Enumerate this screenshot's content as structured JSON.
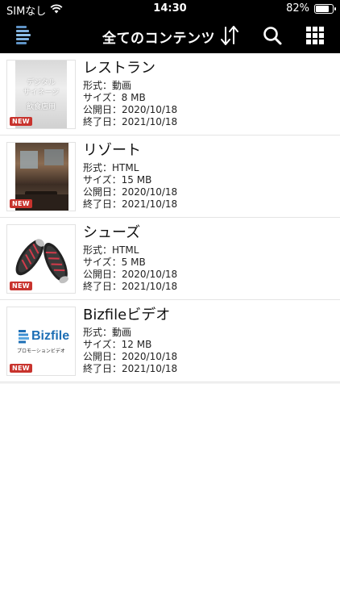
{
  "status_bar": {
    "carrier": "SIMなし",
    "time": "14:30",
    "battery_text": "82%",
    "battery_level": 0.82
  },
  "nav": {
    "title": "全てのコンテンツ",
    "icons": [
      "logo-icon",
      "sort-icon",
      "search-icon",
      "grid-icon"
    ]
  },
  "items": [
    {
      "title": "レストラン",
      "format": "形式：動画",
      "size": "サイズ：8 MB",
      "published": "公開日：2020/10/18",
      "end": "終了日：2021/10/18",
      "badge": "NEW",
      "thumb_text": [
        "デジタル",
        "サイネージ",
        "飲食店用"
      ]
    },
    {
      "title": "リゾート",
      "format": "形式：HTML",
      "size": "サイズ：15 MB",
      "published": "公開日：2020/10/18",
      "end": "終了日：2021/10/18",
      "badge": "NEW"
    },
    {
      "title": "シューズ",
      "format": "形式：HTML",
      "size": "サイズ：5 MB",
      "published": "公開日：2020/10/18",
      "end": "終了日：2021/10/18",
      "badge": "NEW"
    },
    {
      "title": "Bizfileビデオ",
      "format": "形式：動画",
      "size": "サイズ：12 MB",
      "published": "公開日：2020/10/18",
      "end": "終了日：2021/10/18",
      "badge": "NEW",
      "thumb_logo": "Bizfile",
      "thumb_caption": "プロモーションビデオ"
    }
  ],
  "colors": {
    "nav_background": "#000000",
    "badge": "#c8332d",
    "bizfile_blue": "#1e6fb5"
  }
}
